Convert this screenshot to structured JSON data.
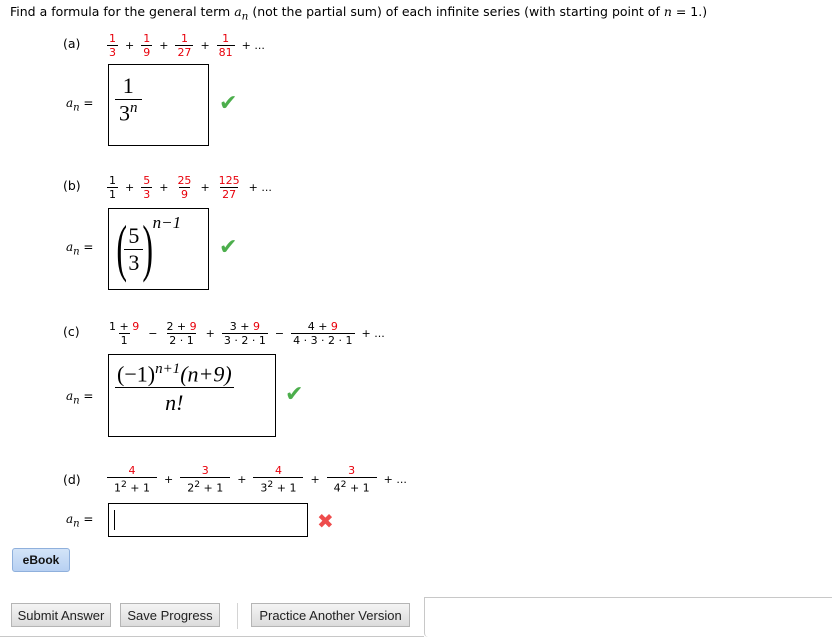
{
  "intro": {
    "before": "Find a formula for the general term ",
    "term": "a",
    "sub": "n",
    "middle": " (not the partial sum) of each infinite series (with starting point of ",
    "var": "n",
    "after": " = 1.)"
  },
  "an_label": {
    "a": "a",
    "n": "n",
    "eq": " ="
  },
  "parts": [
    {
      "label": "(a)",
      "terms": [
        {
          "num": "1",
          "den": "3",
          "op": "+"
        },
        {
          "num": "1",
          "den": "9",
          "op": "+"
        },
        {
          "num": "1",
          "den": "27",
          "op": "+"
        },
        {
          "num": "1",
          "den": "81",
          "op": "+ ..."
        }
      ],
      "answer": {
        "num": "1",
        "base": "3",
        "exp": "n"
      },
      "status": "correct",
      "status_icon": "check-icon"
    },
    {
      "label": "(b)",
      "terms": [
        {
          "num": "1",
          "den": "1",
          "op": "+"
        },
        {
          "num": "5",
          "den": "3",
          "op": "+"
        },
        {
          "num": "25",
          "den": "9",
          "op": "+"
        },
        {
          "num": "125",
          "den": "27",
          "op": "+ ..."
        }
      ],
      "answer": {
        "num": "5",
        "den": "3",
        "exp": "n−1"
      },
      "status": "correct",
      "status_icon": "check-icon"
    },
    {
      "label": "(c)",
      "terms": [
        {
          "num_a": "1 + ",
          "num_b": "9",
          "den": "1",
          "op": "−"
        },
        {
          "num_a": "2 + ",
          "num_b": "9",
          "den": "2 · 1",
          "op": "+"
        },
        {
          "num_a": "3 + ",
          "num_b": "9",
          "den": "3 · 2 · 1",
          "op": "−"
        },
        {
          "num_a": "4 + ",
          "num_b": "9",
          "den": "4 · 3 · 2 · 1",
          "op": "+ ..."
        }
      ],
      "answer": {
        "sign": "(−1)",
        "exp": "n+1",
        "factor": "(n+9)",
        "den": "n!"
      },
      "status": "correct",
      "status_icon": "check-icon"
    },
    {
      "label": "(d)",
      "terms": [
        {
          "num": "4",
          "base": "1",
          "rest": " + 1",
          "op": "+"
        },
        {
          "num": "3",
          "base": "2",
          "rest": " + 1",
          "op": "+"
        },
        {
          "num": "4",
          "base": "3",
          "rest": " + 1",
          "op": "+"
        },
        {
          "num": "3",
          "base": "4",
          "rest": " + 1",
          "op": "+ ..."
        }
      ],
      "sq": "2",
      "answer": {
        "value": ""
      },
      "status": "incorrect",
      "status_icon": "cross-icon"
    }
  ],
  "icons": {
    "check": "✔",
    "cross": "✖"
  },
  "colors": {
    "correct": "#4cae4c",
    "incorrect": "#ee4c4c",
    "highlight": "#e8000b"
  },
  "buttons": {
    "ebook": "eBook",
    "submit": "Submit Answer",
    "save": "Save Progress",
    "practice": "Practice Another Version"
  }
}
